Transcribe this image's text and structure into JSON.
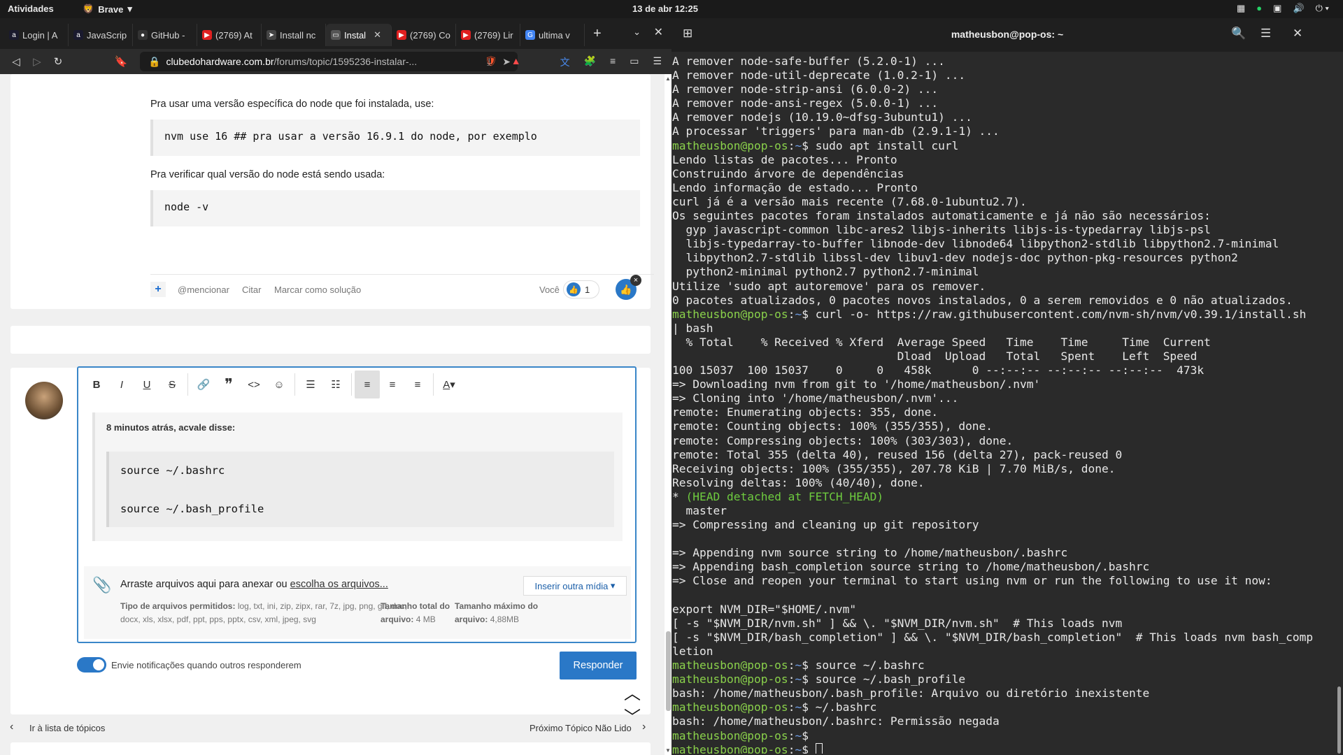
{
  "topbar": {
    "activities": "Atividades",
    "app": "Brave",
    "datetime": "13 de abr  12:25"
  },
  "browser": {
    "tabs": [
      {
        "label": "Login | A",
        "color": "#1a1a2e",
        "glyph": "a"
      },
      {
        "label": "JavaScrip",
        "color": "#1a1a2e",
        "glyph": "a"
      },
      {
        "label": "GitHub -",
        "color": "#333333",
        "glyph": "●"
      },
      {
        "label": "(2769) At",
        "color": "#e02020",
        "glyph": "▶"
      },
      {
        "label": "Install nc",
        "color": "#444444",
        "glyph": "➤"
      },
      {
        "label": "Instal",
        "color": "#555555",
        "glyph": "▭",
        "active": true
      },
      {
        "label": "(2769) Co",
        "color": "#e02020",
        "glyph": "▶"
      },
      {
        "label": "(2769) Lir",
        "color": "#e02020",
        "glyph": "▶"
      },
      {
        "label": "ultima v",
        "color": "#4285f4",
        "glyph": "G"
      }
    ],
    "url_domain": "clubedohardware.com.br",
    "url_path": "/forums/topic/1595236-instalar-..."
  },
  "post": {
    "text1": "Pra usar uma versão específica do node que foi instalada, use:",
    "code1": "nvm use 16 ## pra usar a versão 16.9.1 do node, por exemplo",
    "text2": "Pra verificar qual versão do node está sendo usada:",
    "code2": "node -v",
    "mention": "@mencionar",
    "quote": "Citar",
    "solution": "Marcar como solução",
    "you": "Você",
    "reactions": "1"
  },
  "editor": {
    "quote_header": "8 minutos atrás, acvale disse:",
    "quote_line1": "source ~/.bashrc",
    "quote_line2": "source ~/.bash_profile",
    "drag_text": "Arraste arquivos aqui para anexar ou ",
    "choose_files": "escolha os arquivos...",
    "insert_media": "Inserir outra mídia",
    "allowed_types_label": "Tipo de arquivos permitidos:",
    "allowed_types": "log, txt, ini, zip, zipx, rar, 7z, jpg, png, gif, doc, docx, xls, xlsx, pdf, ppt, pps, pptx, csv, xml, jpeg, svg",
    "total_size_label": "Tamanho total do arquivo:",
    "total_size": "4 MB",
    "max_size_label": "Tamanho máximo do arquivo:",
    "max_size": "4,88MB",
    "notify": "Envie notificações quando outros responderem",
    "respond": "Responder"
  },
  "pagination": {
    "back": "Ir à lista de tópicos",
    "next": "Próximo Tópico Não Lido"
  },
  "terminal": {
    "title": "matheusbon@pop-os: ~",
    "prompt_user": "matheusbon@pop-os",
    "prompt_path": "~",
    "lines": [
      {
        "t": "A remover node-safe-buffer (5.2.0-1) ..."
      },
      {
        "t": "A remover node-util-deprecate (1.0.2-1) ..."
      },
      {
        "t": "A remover node-strip-ansi (6.0.0-2) ..."
      },
      {
        "t": "A remover node-ansi-regex (5.0.0-1) ..."
      },
      {
        "t": "A remover nodejs (10.19.0~dfsg-3ubuntu1) ..."
      },
      {
        "t": "A processar 'triggers' para man-db (2.9.1-1) ..."
      },
      {
        "p": true,
        "t": "sudo apt install curl"
      },
      {
        "t": "Lendo listas de pacotes... Pronto"
      },
      {
        "t": "Construindo árvore de dependências"
      },
      {
        "t": "Lendo informação de estado... Pronto"
      },
      {
        "t": "curl já é a versão mais recente (7.68.0-1ubuntu2.7)."
      },
      {
        "t": "Os seguintes pacotes foram instalados automaticamente e já não são necessários:"
      },
      {
        "t": "  gyp javascript-common libc-ares2 libjs-inherits libjs-is-typedarray libjs-psl"
      },
      {
        "t": "  libjs-typedarray-to-buffer libnode-dev libnode64 libpython2-stdlib libpython2.7-minimal"
      },
      {
        "t": "  libpython2.7-stdlib libssl-dev libuv1-dev nodejs-doc python-pkg-resources python2"
      },
      {
        "t": "  python2-minimal python2.7 python2.7-minimal"
      },
      {
        "t": "Utilize 'sudo apt autoremove' para os remover."
      },
      {
        "t": "0 pacotes atualizados, 0 pacotes novos instalados, 0 a serem removidos e 0 não atualizados."
      },
      {
        "p": true,
        "t": "curl -o- https://raw.githubusercontent.com/nvm-sh/nvm/v0.39.1/install.sh"
      },
      {
        "t": "| bash"
      },
      {
        "t": "  % Total    % Received % Xferd  Average Speed   Time    Time     Time  Current"
      },
      {
        "t": "                                 Dload  Upload   Total   Spent    Left  Speed"
      },
      {
        "t": "100 15037  100 15037    0     0   458k      0 --:--:-- --:--:-- --:--:--  473k"
      },
      {
        "t": "=> Downloading nvm from git to '/home/matheusbon/.nvm'"
      },
      {
        "t": "=> Cloning into '/home/matheusbon/.nvm'..."
      },
      {
        "t": "remote: Enumerating objects: 355, done."
      },
      {
        "t": "remote: Counting objects: 100% (355/355), done."
      },
      {
        "t": "remote: Compressing objects: 100% (303/303), done."
      },
      {
        "t": "remote: Total 355 (delta 40), reused 156 (delta 27), pack-reused 0"
      },
      {
        "t": "Receiving objects: 100% (355/355), 207.78 KiB | 7.70 MiB/s, done."
      },
      {
        "t": "Resolving deltas: 100% (40/40), done."
      },
      {
        "t": "* ",
        "g": "(HEAD detached at FETCH_HEAD)"
      },
      {
        "t": "  master"
      },
      {
        "t": "=> Compressing and cleaning up git repository"
      },
      {
        "t": ""
      },
      {
        "t": "=> Appending nvm source string to /home/matheusbon/.bashrc"
      },
      {
        "t": "=> Appending bash_completion source string to /home/matheusbon/.bashrc"
      },
      {
        "t": "=> Close and reopen your terminal to start using nvm or run the following to use it now:"
      },
      {
        "t": ""
      },
      {
        "t": "export NVM_DIR=\"$HOME/.nvm\""
      },
      {
        "t": "[ -s \"$NVM_DIR/nvm.sh\" ] && \\. \"$NVM_DIR/nvm.sh\"  # This loads nvm"
      },
      {
        "t": "[ -s \"$NVM_DIR/bash_completion\" ] && \\. \"$NVM_DIR/bash_completion\"  # This loads nvm bash_comp"
      },
      {
        "t": "letion"
      },
      {
        "p": true,
        "t": "source ~/.bashrc"
      },
      {
        "p": true,
        "t": "source ~/.bash_profile"
      },
      {
        "t": "bash: /home/matheusbon/.bash_profile: Arquivo ou diretório inexistente"
      },
      {
        "p": true,
        "t": "~/.bashrc"
      },
      {
        "t": "bash: /home/matheusbon/.bashrc: Permissão negada"
      },
      {
        "p": true,
        "t": ""
      },
      {
        "p": true,
        "t": "",
        "cursor": true
      }
    ]
  }
}
